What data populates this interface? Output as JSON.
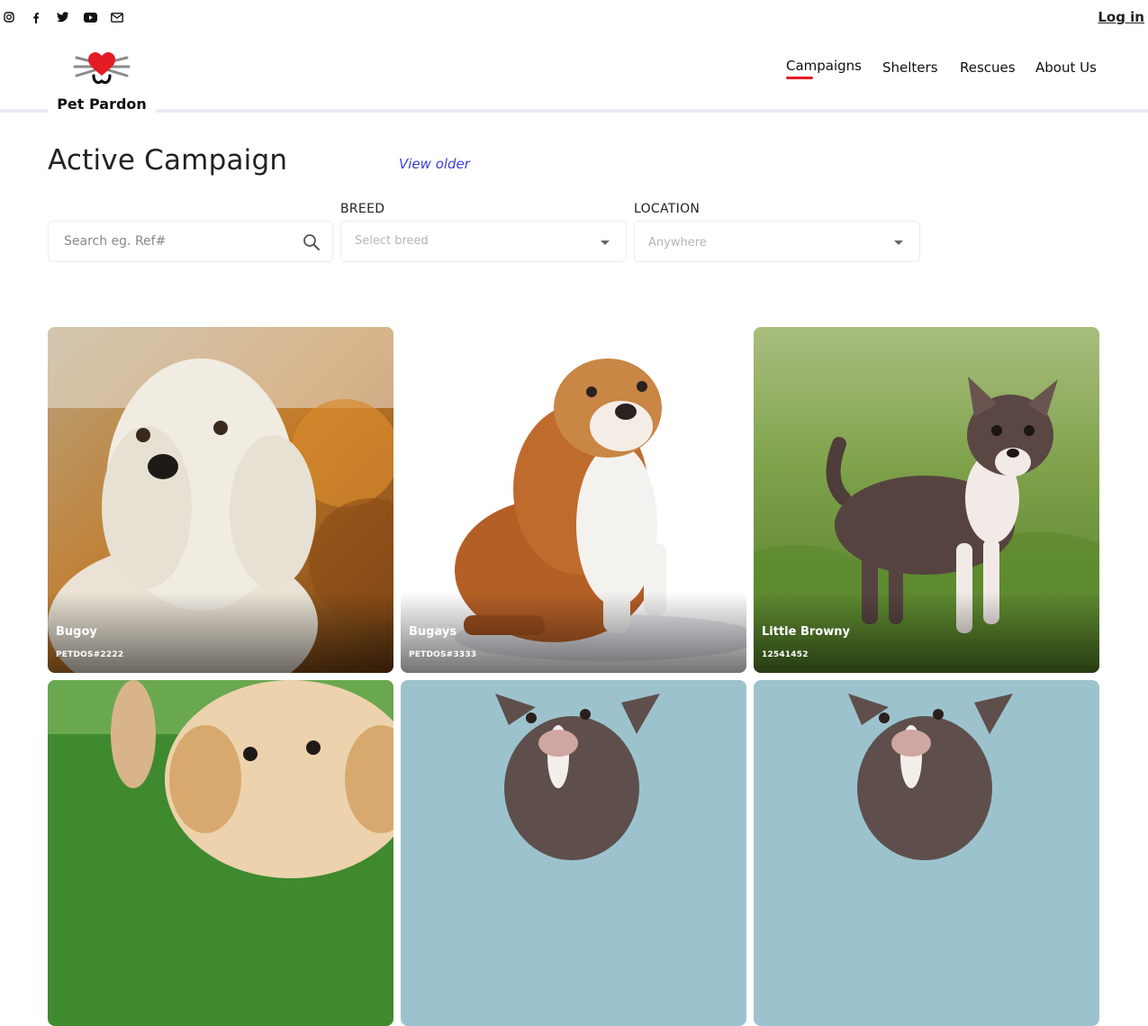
{
  "topbar": {
    "social_icons": [
      "instagram-icon",
      "facebook-icon",
      "twitter-icon",
      "youtube-icon",
      "mail-icon"
    ],
    "login_label": "Log in"
  },
  "brand": {
    "name": "Pet Pardon",
    "accent": "#e31b23"
  },
  "nav": {
    "items": [
      {
        "label": "Campaigns",
        "active": true
      },
      {
        "label": "Shelters",
        "active": false
      },
      {
        "label": "Rescues",
        "active": false
      },
      {
        "label": "About Us",
        "active": false
      }
    ]
  },
  "main": {
    "title": "Active Campaign",
    "view_older": "View older"
  },
  "filters": {
    "search_placeholder": "Search eg. Ref#",
    "breed_label": "BREED",
    "breed_placeholder": "Select breed",
    "location_label": "LOCATION",
    "location_placeholder": "Anywhere"
  },
  "cards": [
    {
      "name": "Bugoy",
      "ref": "PETDOS#2222"
    },
    {
      "name": "Bugays",
      "ref": "PETDOS#3333"
    },
    {
      "name": "Little Browny",
      "ref": "12541452"
    },
    {
      "name": "",
      "ref": ""
    },
    {
      "name": "",
      "ref": ""
    },
    {
      "name": "",
      "ref": ""
    }
  ]
}
